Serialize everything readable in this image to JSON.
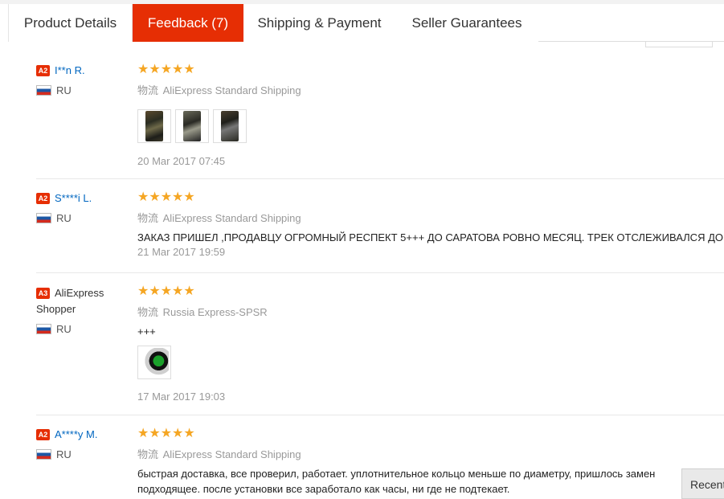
{
  "tabs": {
    "product_details": "Product Details",
    "feedback": "Feedback (7)",
    "shipping": "Shipping & Payment",
    "guarantees": "Seller Guarantees"
  },
  "icons": {
    "star": "star-icon",
    "flag": "russia-flag-icon"
  },
  "colors": {
    "accent": "#e62e04",
    "link": "#0066c0",
    "star": "#f5a623"
  },
  "feedback": [
    {
      "level": "A2",
      "name": "I**n R.",
      "country": "RU",
      "stars": "★★★★★",
      "rating": 5,
      "shipping_label": "物流",
      "shipping": "AliExpress Standard Shipping",
      "text": "",
      "date": "20 Mar 2017 07:45"
    },
    {
      "level": "A2",
      "name": "S****i L.",
      "country": "RU",
      "stars": "★★★★★",
      "rating": 5,
      "shipping_label": "物流",
      "shipping": "AliExpress Standard Shipping",
      "text": "ЗАКАЗ ПРИШЕЛ ,ПРОДАВЦУ ОГРОМНЫЙ РЕСПЕКТ 5+++ ДО САРАТОВА РОВНО МЕСЯЦ. ТРЕК ОТСЛЕЖИВАЛСЯ ДО ТОЧ",
      "date": "21 Mar 2017 19:59"
    },
    {
      "level": "A3",
      "name": "AliExpress Shopper",
      "country": "RU",
      "stars": "★★★★★",
      "rating": 5,
      "shipping_label": "物流",
      "shipping": "Russia Express-SPSR",
      "text": "+++",
      "date": "17 Mar 2017 19:03"
    },
    {
      "level": "A2",
      "name": "A****y M.",
      "country": "RU",
      "stars": "★★★★★",
      "rating": 5,
      "shipping_label": "物流",
      "shipping": "AliExpress Standard Shipping",
      "text": "быстрая доставка, все проверил, работает. уплотнительное кольцо меньше по диаметру, пришлось замен подходящее. после установки все заработало как часы, ни где не подтекает.",
      "date": ""
    }
  ],
  "recent": "Recent"
}
